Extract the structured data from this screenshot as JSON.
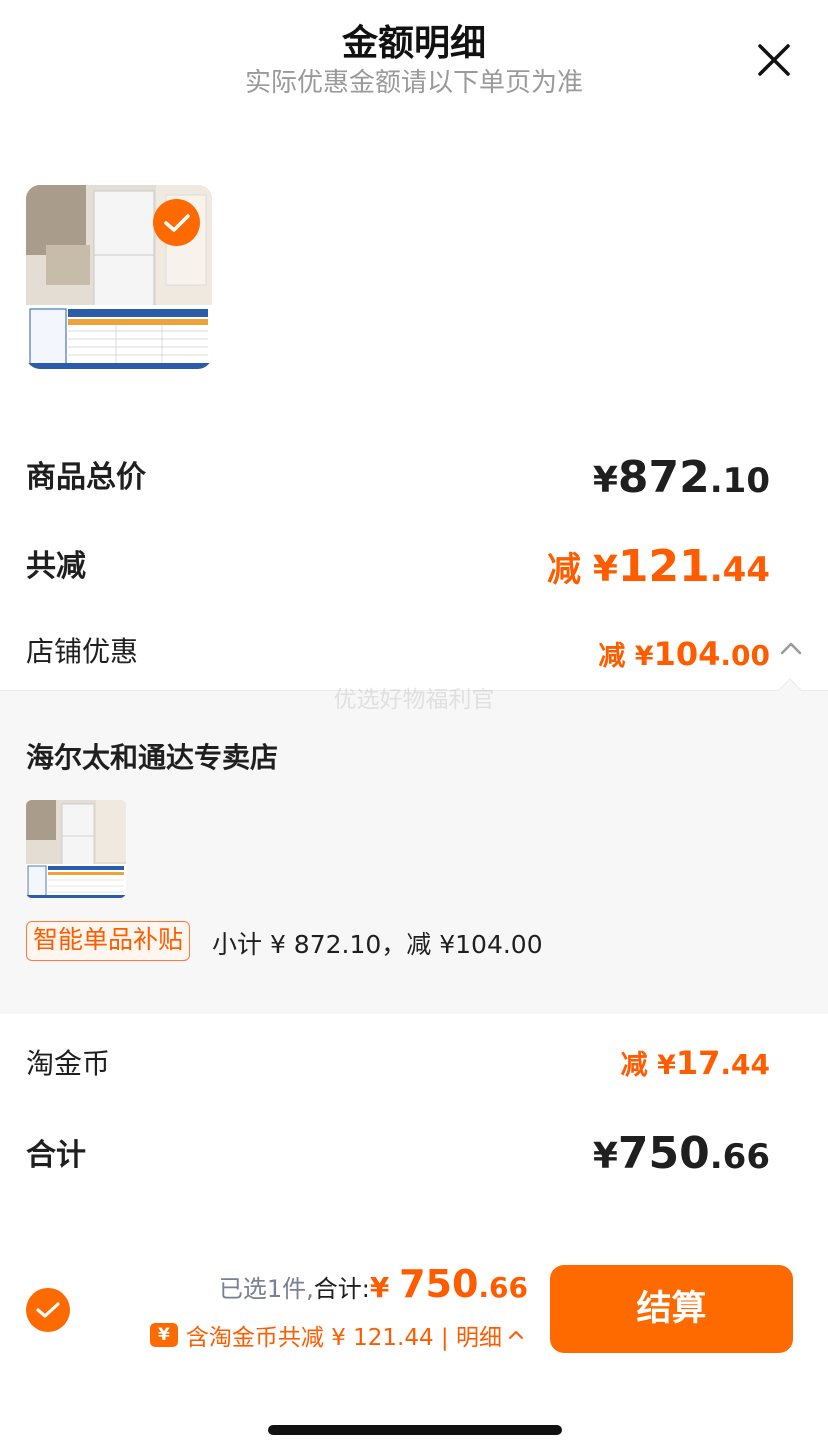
{
  "header": {
    "title": "金额明细",
    "subtitle": "实际优惠金额请以下单页为准",
    "close_icon": "close-icon"
  },
  "product": {
    "image_icon": "refrigerator-product-image",
    "selected": true
  },
  "summary": {
    "total": {
      "label": "商品总价",
      "yen": "¥",
      "int": "872",
      "dec": ".10"
    },
    "discount": {
      "label": "共减",
      "prefix": "减 ",
      "yen": "¥",
      "int": "121",
      "dec": ".44"
    },
    "store_promo": {
      "label": "店铺优惠",
      "prefix": "减 ",
      "yen": "¥",
      "int": "104",
      "dec": ".00",
      "expanded": true
    }
  },
  "watermark": "优选好物福利官",
  "store_panel": {
    "store_name": "海尔太和通达专卖店",
    "tag": "智能单品补贴",
    "subtotal_text": "小计 ¥ 872.10，减 ¥104.00"
  },
  "coins": {
    "label": "淘金币",
    "prefix": "减 ",
    "yen": "¥",
    "int": "17",
    "dec": ".44"
  },
  "grand_total": {
    "label": "合计",
    "yen": "¥",
    "int": "750",
    "dec": ".66"
  },
  "bottom_bar": {
    "selected_text": "已选1件,",
    "total_label": "合计:",
    "yen": "¥ ",
    "int": "750",
    "dec": ".66",
    "coin_line": "含淘金币共减 ¥ 121.44 | 明细",
    "coin_icon_glyph": "¥",
    "checkout_label": "结算"
  },
  "colors": {
    "accent": "#ff6a00",
    "discount_text": "#ff5c00",
    "panel_bg": "#f7f7f7"
  }
}
